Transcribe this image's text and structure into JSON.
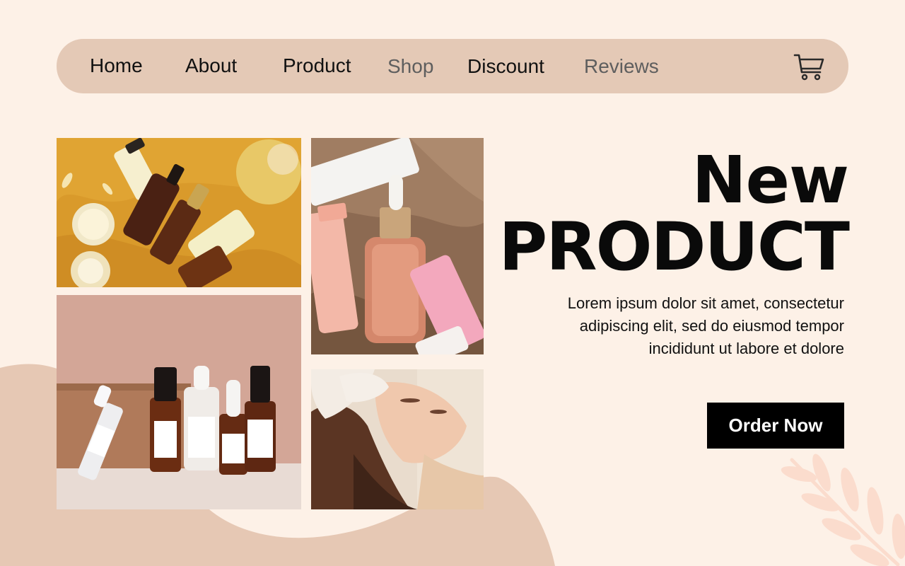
{
  "nav": {
    "items": [
      {
        "label": "Home"
      },
      {
        "label": "About"
      },
      {
        "label": "Product"
      },
      {
        "label": "Shop"
      },
      {
        "label": "Discount"
      },
      {
        "label": "Reviews"
      }
    ],
    "cart_icon": "shopping-cart-icon"
  },
  "hero": {
    "title_line1": "New",
    "title_line2": "PRODUCT",
    "description": "Lorem ipsum dolor sit amet, consectetur adipiscing elit, sed do eiusmod tempor incididunt ut labore et dolore",
    "cta_label": "Order Now"
  },
  "gallery": {
    "images": [
      {
        "name": "cosmetic-bottles-on-orange-fabric"
      },
      {
        "name": "serum-and-tubes-on-brown-fabric"
      },
      {
        "name": "serum-bottles-on-pink-background"
      },
      {
        "name": "woman-receiving-facial-treatment"
      }
    ]
  },
  "colors": {
    "background": "#fdf1e7",
    "nav_background": "#e4c9b6",
    "blob": "#e6c8b4",
    "leaf": "#fbdccd",
    "button": "#000000",
    "button_text": "#ffffff"
  }
}
